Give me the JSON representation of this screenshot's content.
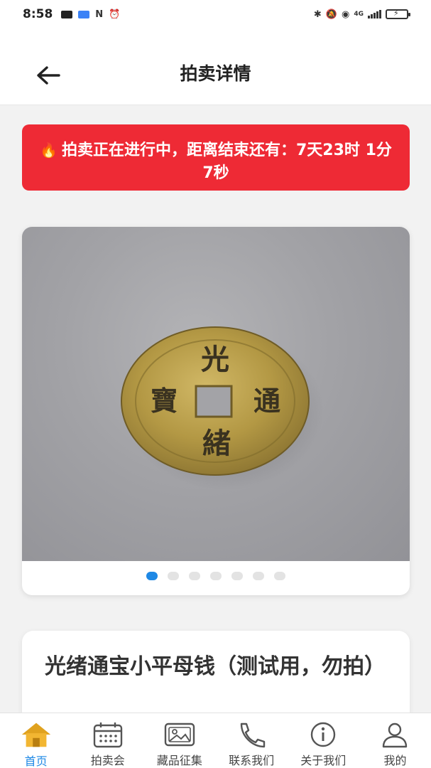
{
  "status_bar": {
    "time": "8:58",
    "network": "4G"
  },
  "header": {
    "title": "拍卖详情",
    "back_icon": "arrow-left-icon"
  },
  "countdown": {
    "icon": "fire-icon",
    "text": "拍卖正在进行中，距离结束还有：7天23时 1分 7秒"
  },
  "gallery": {
    "image_subject": "coin-photo",
    "slide_count": 7,
    "active_index": 0
  },
  "item": {
    "title": "光绪通宝小平母钱（测试用，勿拍）"
  },
  "nav": {
    "items": [
      {
        "label": "首页",
        "icon": "home-icon",
        "active": true
      },
      {
        "label": "拍卖会",
        "icon": "calendar-icon",
        "active": false
      },
      {
        "label": "藏品征集",
        "icon": "image-icon",
        "active": false
      },
      {
        "label": "联系我们",
        "icon": "phone-icon",
        "active": false
      },
      {
        "label": "关于我们",
        "icon": "info-icon",
        "active": false
      },
      {
        "label": "我的",
        "icon": "user-icon",
        "active": false
      }
    ]
  },
  "colors": {
    "accent": "#1e88e5",
    "countdown_bg": "#ee2a35",
    "home_icon": "#f2b632"
  }
}
